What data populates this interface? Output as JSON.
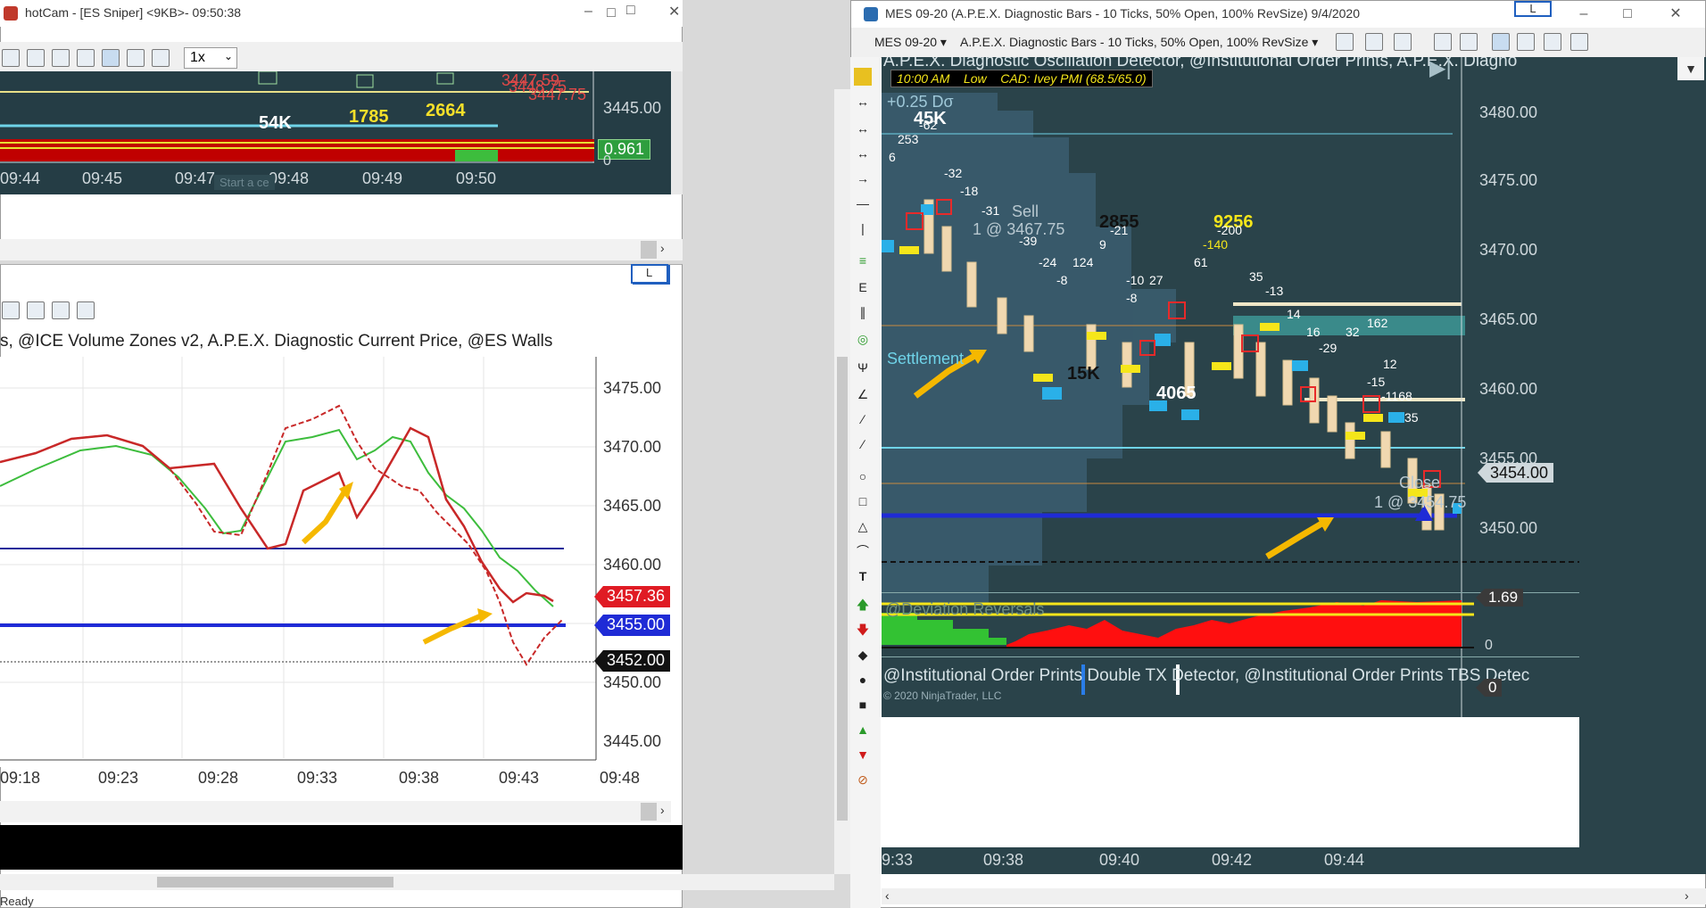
{
  "left_top_window": {
    "title": "hotCam - [ES Sniper] <9KB>- 09:50:38",
    "toolbar": {
      "zoom": "1x"
    },
    "price_labels": [
      "3445.00",
      "0"
    ],
    "indicator_value": "0.961",
    "overlay_prices": [
      "3447.59",
      "3448.75",
      "3447.75"
    ],
    "volume_labels": [
      "54K",
      "1785",
      "2664"
    ],
    "time_labels": [
      "09:44",
      "09:45",
      "09:47",
      "09:48",
      "09:49",
      "09:50"
    ],
    "watermark": "Start a ce"
  },
  "left_bottom_window": {
    "l_badge": "L",
    "indicator_text": "s, @ICE Volume Zones v2, A.P.E.X. Diagnostic Current Price, @ES Walls",
    "price_labels": [
      "3475.00",
      "3470.00",
      "3465.00",
      "3460.00",
      "3450.00",
      "3445.00"
    ],
    "tags": [
      {
        "value": "3457.36",
        "color": "#e01b24"
      },
      {
        "value": "3455.00",
        "color": "#1f2bd6"
      },
      {
        "value": "3452.00",
        "color": "#111111"
      }
    ],
    "time_labels": [
      "09:18",
      "09:23",
      "09:28",
      "09:33",
      "09:38",
      "09:43",
      "09:48"
    ],
    "status": "Ready"
  },
  "right_window": {
    "title": "MES 09-20 (A.P.E.X. Diagnostic Bars - 10 Ticks, 50% Open, 100% RevSize)  9/4/2020",
    "l_badge": "L",
    "instrument": "MES 09-20",
    "bar_type": "A.P.E.X. Diagnostic Bars - 10 Ticks, 50% Open, 100% RevSize",
    "indicator_text": "A.P.E.X. Diagnostic Oscillation Detector, @Institutional Order Prints, A.P.E.X. Diagno",
    "news": {
      "time": "10:00 AM",
      "level": "Low",
      "text": "CAD: Ivey PMI (68.5/65.0)"
    },
    "price_labels": [
      "3480.00",
      "3475.00",
      "3470.00",
      "3465.00",
      "3460.00",
      "3455.00",
      "3450.00"
    ],
    "current_price": "3454.00",
    "dev_label": "+0.25 Dσ",
    "labels": {
      "vol45k": "45K",
      "n253": "253",
      "n62": "-62",
      "n6": "6",
      "n32": "-32",
      "n18": "-18",
      "n31": "-31",
      "sell": "Sell",
      "sell_fill": "1 @ 3467.75",
      "n39": "-39",
      "n2855": "2855",
      "n21": "-21",
      "n9": "9",
      "n9256": "9256",
      "n200": "-200",
      "n140": "-140",
      "n24": "-24",
      "n8": "-8",
      "n124": "124",
      "n10": "-10",
      "n27": "27",
      "n8b": "-8",
      "n61": "61",
      "n35": "35",
      "n13": "-13",
      "settlement": "Settlement",
      "vol15k": "15K",
      "vol4065": "4065",
      "n14": "14",
      "n16": "16",
      "n32b": "32",
      "n162": "162",
      "n29": "-29",
      "n12": "12",
      "n15": "-15",
      "n1168": "-1168",
      "n35b": "35",
      "close": "Close",
      "close_fill": "1 @ 3454.75"
    },
    "subpanel": {
      "name": "@Deviation Reversals",
      "value": "1.69",
      "zero": "0"
    },
    "bottom_indicator_text": "@Institutional Order Prints Double TX Detector, @Institutional Order Prints TBS Detec",
    "bottom_value": "0",
    "copyright": "© 2020 NinjaTrader, LLC",
    "time_labels": [
      "9:33",
      "09:38",
      "09:40",
      "09:42",
      "09:44"
    ]
  }
}
